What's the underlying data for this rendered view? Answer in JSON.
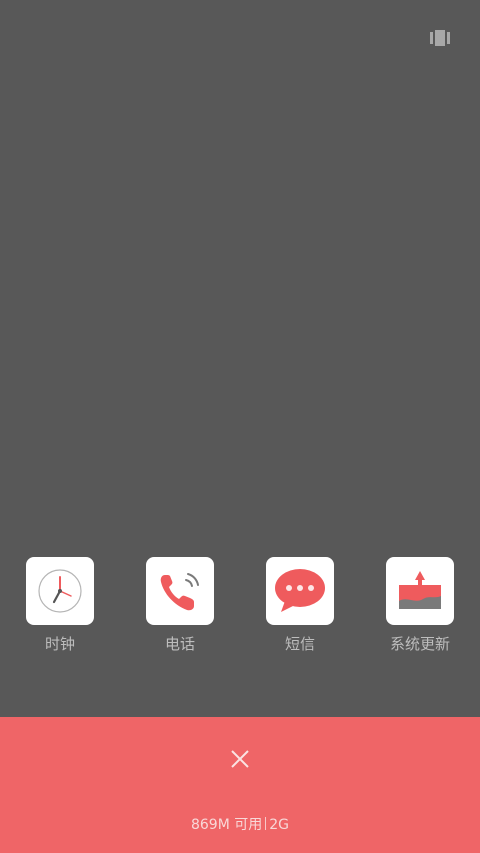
{
  "top_bar": {
    "toggle_icon": "task-view-toggle-icon"
  },
  "apps": [
    {
      "label": "时钟",
      "icon": "clock-icon"
    },
    {
      "label": "电话",
      "icon": "phone-icon"
    },
    {
      "label": "短信",
      "icon": "message-icon"
    },
    {
      "label": "系统更新",
      "icon": "system-update-icon"
    }
  ],
  "bottom_panel": {
    "close_icon": "close-icon",
    "memory_available": "869M 可用",
    "memory_total": "2G"
  },
  "colors": {
    "background": "#585858",
    "panel": "#ef6567",
    "accent": "#ef6567",
    "label": "#bdbdbd"
  }
}
